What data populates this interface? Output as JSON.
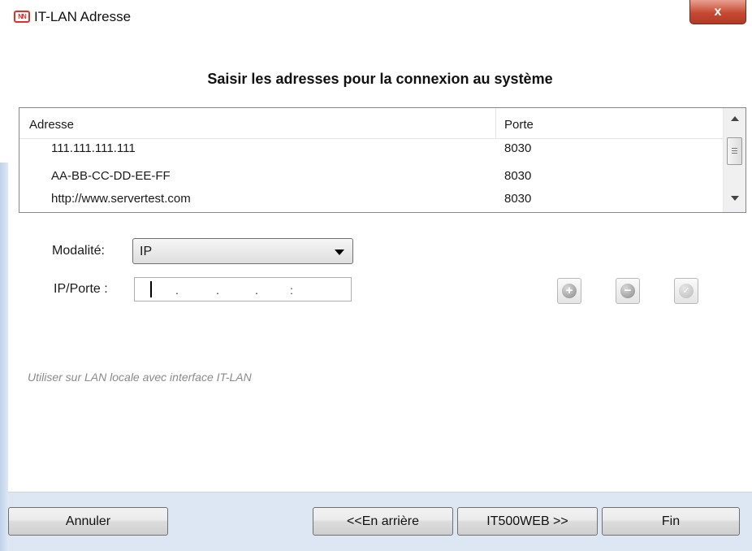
{
  "window": {
    "title": "IT-LAN Adresse",
    "icon_text": "NN",
    "close_label": "x"
  },
  "heading": "Saisir les adresses pour la connexion au système",
  "table": {
    "columns": [
      "Adresse",
      "Porte"
    ],
    "rows": [
      {
        "address": "111.111.111.111",
        "port": "8030"
      },
      {
        "address": "AA-BB-CC-DD-EE-FF",
        "port": "8030"
      },
      {
        "address": "http://www.servertest.com",
        "port": "8030"
      }
    ]
  },
  "form": {
    "mode_label": "Modalité:",
    "mode_value": "IP",
    "ip_label": "IP/Porte :",
    "ip_separators": [
      ".",
      ".",
      ".",
      ":"
    ]
  },
  "actions": {
    "add_icon": "plus-circle-icon",
    "remove_icon": "minus-circle-icon",
    "confirm_icon": "check-circle-icon"
  },
  "hint": "Utiliser sur LAN locale avec interface IT-LAN",
  "buttons": {
    "cancel": "Annuler",
    "back": "<<En arrière",
    "next": "IT500WEB >>",
    "finish": "Fin"
  },
  "colors": {
    "close_button": "#c64a33",
    "footer_bg": "#dde7f3",
    "icon_red": "#e0302a"
  }
}
